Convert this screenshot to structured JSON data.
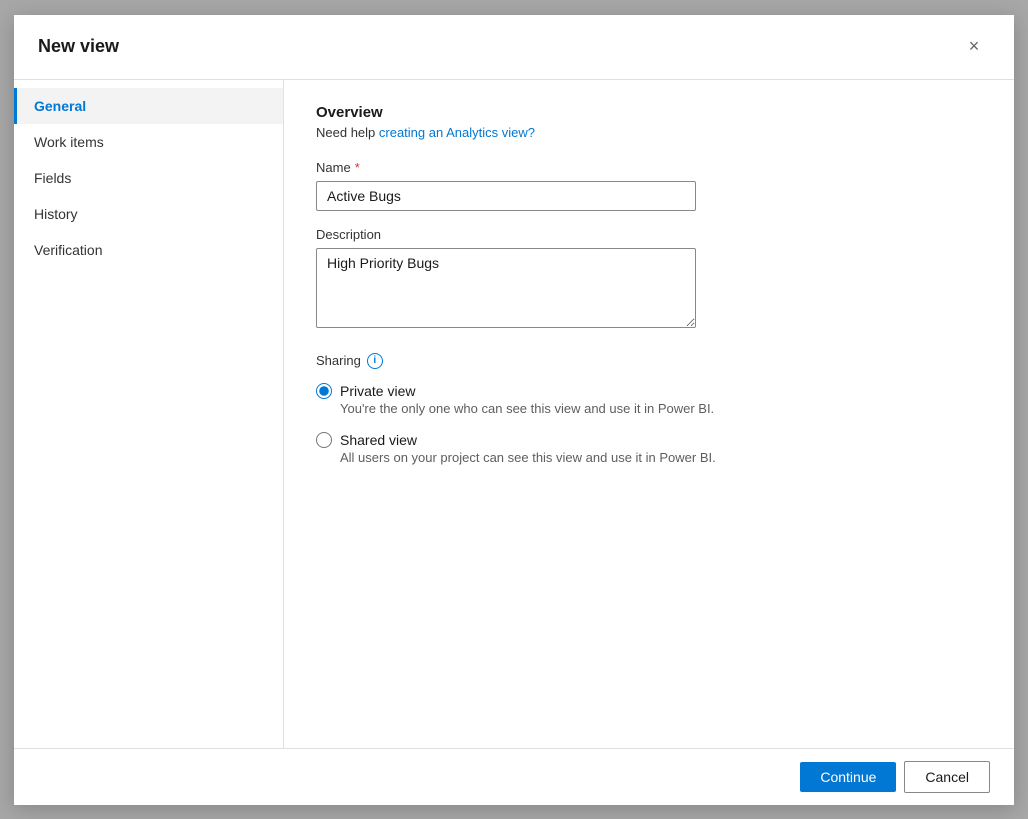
{
  "dialog": {
    "title": "New view",
    "close_label": "×"
  },
  "sidebar": {
    "items": [
      {
        "id": "general",
        "label": "General",
        "active": true
      },
      {
        "id": "work-items",
        "label": "Work items",
        "active": false
      },
      {
        "id": "fields",
        "label": "Fields",
        "active": false
      },
      {
        "id": "history",
        "label": "History",
        "active": false
      },
      {
        "id": "verification",
        "label": "Verification",
        "active": false
      }
    ]
  },
  "main": {
    "section_title": "Overview",
    "help_text_prefix": "Need help ",
    "help_link_label": "creating an Analytics view?",
    "help_link_url": "#",
    "name_label": "Name",
    "name_required": true,
    "name_value": "Active Bugs",
    "name_placeholder": "",
    "description_label": "Description",
    "description_value": "High Priority Bugs",
    "description_placeholder": "",
    "sharing_label": "Sharing",
    "sharing_info_icon": "i",
    "private_view_label": "Private view",
    "private_view_description": "You're the only one who can see this view and use it in Power BI.",
    "shared_view_label": "Shared view",
    "shared_view_description": "All users on your project can see this view and use it in Power BI.",
    "selected_sharing": "private"
  },
  "footer": {
    "continue_label": "Continue",
    "cancel_label": "Cancel"
  }
}
